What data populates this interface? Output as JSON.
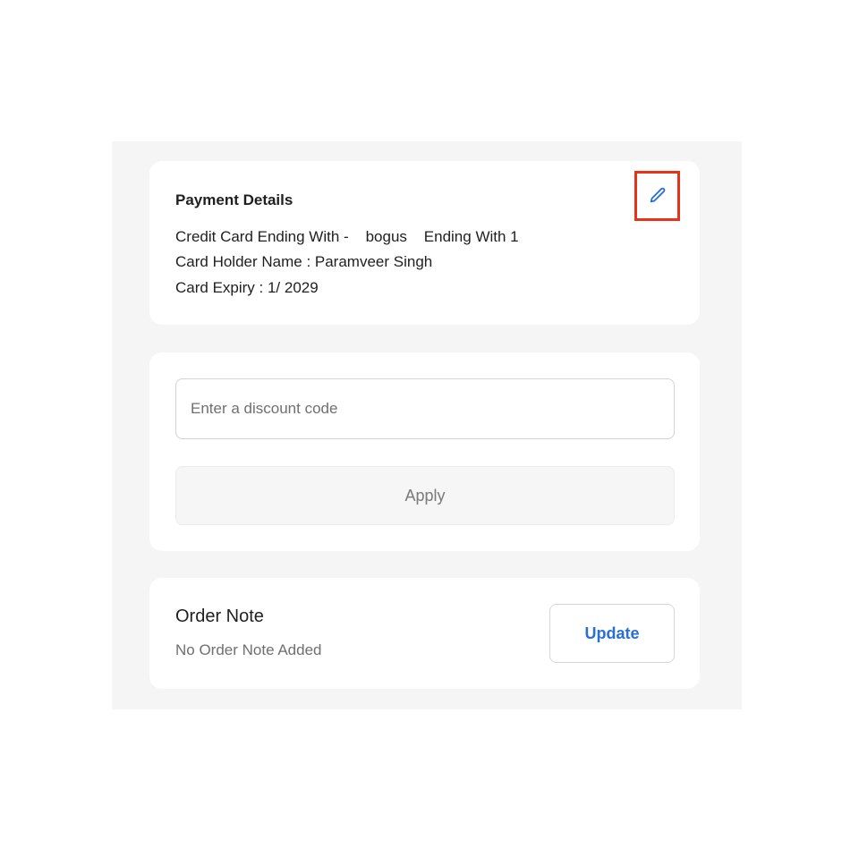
{
  "payment": {
    "title": "Payment Details",
    "card_line": "Credit Card Ending With -    bogus    Ending With 1",
    "holder_line": "Card Holder Name : Paramveer Singh",
    "expiry_line": "Card Expiry : 1/ 2029",
    "edit_icon": "pencil-icon",
    "highlight_color": "#e8321a",
    "accent_color": "#2a6fd6"
  },
  "discount": {
    "placeholder": "Enter a discount code",
    "value": "",
    "apply_label": "Apply"
  },
  "order_note": {
    "title": "Order Note",
    "subtitle": "No Order Note Added",
    "update_label": "Update"
  }
}
